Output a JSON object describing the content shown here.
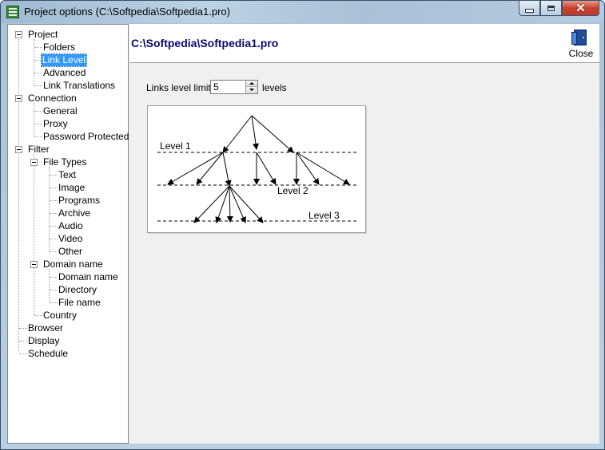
{
  "window": {
    "title": "Project options (C:\\Softpedia\\Softpedia1.pro)"
  },
  "tree": {
    "items": [
      {
        "label": "Project"
      },
      {
        "label": "Folders"
      },
      {
        "label": "Link Level"
      },
      {
        "label": "Advanced"
      },
      {
        "label": "Link Translations"
      },
      {
        "label": "Connection"
      },
      {
        "label": "General"
      },
      {
        "label": "Proxy"
      },
      {
        "label": "Password Protected"
      },
      {
        "label": "Filter"
      },
      {
        "label": "File Types"
      },
      {
        "label": "Text"
      },
      {
        "label": "Image"
      },
      {
        "label": "Programs"
      },
      {
        "label": "Archive"
      },
      {
        "label": "Audio"
      },
      {
        "label": "Video"
      },
      {
        "label": "Other"
      },
      {
        "label": "Domain name"
      },
      {
        "label": "Domain name"
      },
      {
        "label": "Directory"
      },
      {
        "label": "File name"
      },
      {
        "label": "Country"
      },
      {
        "label": "Browser"
      },
      {
        "label": "Display"
      },
      {
        "label": "Schedule"
      }
    ],
    "selected": "Link Level"
  },
  "header": {
    "path": "C:\\Softpedia\\Softpedia1.pro",
    "close_label": "Close"
  },
  "settings": {
    "limit_label": "Links level limit",
    "limit_value": "5",
    "levels_label": "levels"
  },
  "diagram": {
    "level1": "Level 1",
    "level2": "Level 2",
    "level3": "Level 3"
  }
}
